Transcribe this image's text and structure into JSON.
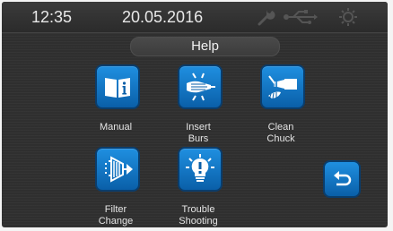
{
  "status_bar": {
    "time": "12:35",
    "date": "20.05.2016",
    "icons": [
      "wrench-icon",
      "usb-icon",
      "sun-icon"
    ]
  },
  "header": {
    "title": "Help"
  },
  "help_items": [
    {
      "label_line1": "Manual",
      "label_line2": "",
      "icon": "manual-book-icon"
    },
    {
      "label_line1": "Insert",
      "label_line2": "Burs",
      "icon": "insert-burs-icon"
    },
    {
      "label_line1": "Clean",
      "label_line2": "Chuck",
      "icon": "clean-chuck-icon"
    },
    {
      "label_line1": "Filter",
      "label_line2": "Change",
      "icon": "filter-change-icon"
    },
    {
      "label_line1": "Trouble",
      "label_line2": "Shooting",
      "icon": "troubleshooting-bulb-icon"
    }
  ],
  "back": {
    "icon": "back-arrow-icon"
  },
  "colors": {
    "accent": "#1478c8",
    "background": "#2f2f2f",
    "text": "#e4e4e4"
  }
}
